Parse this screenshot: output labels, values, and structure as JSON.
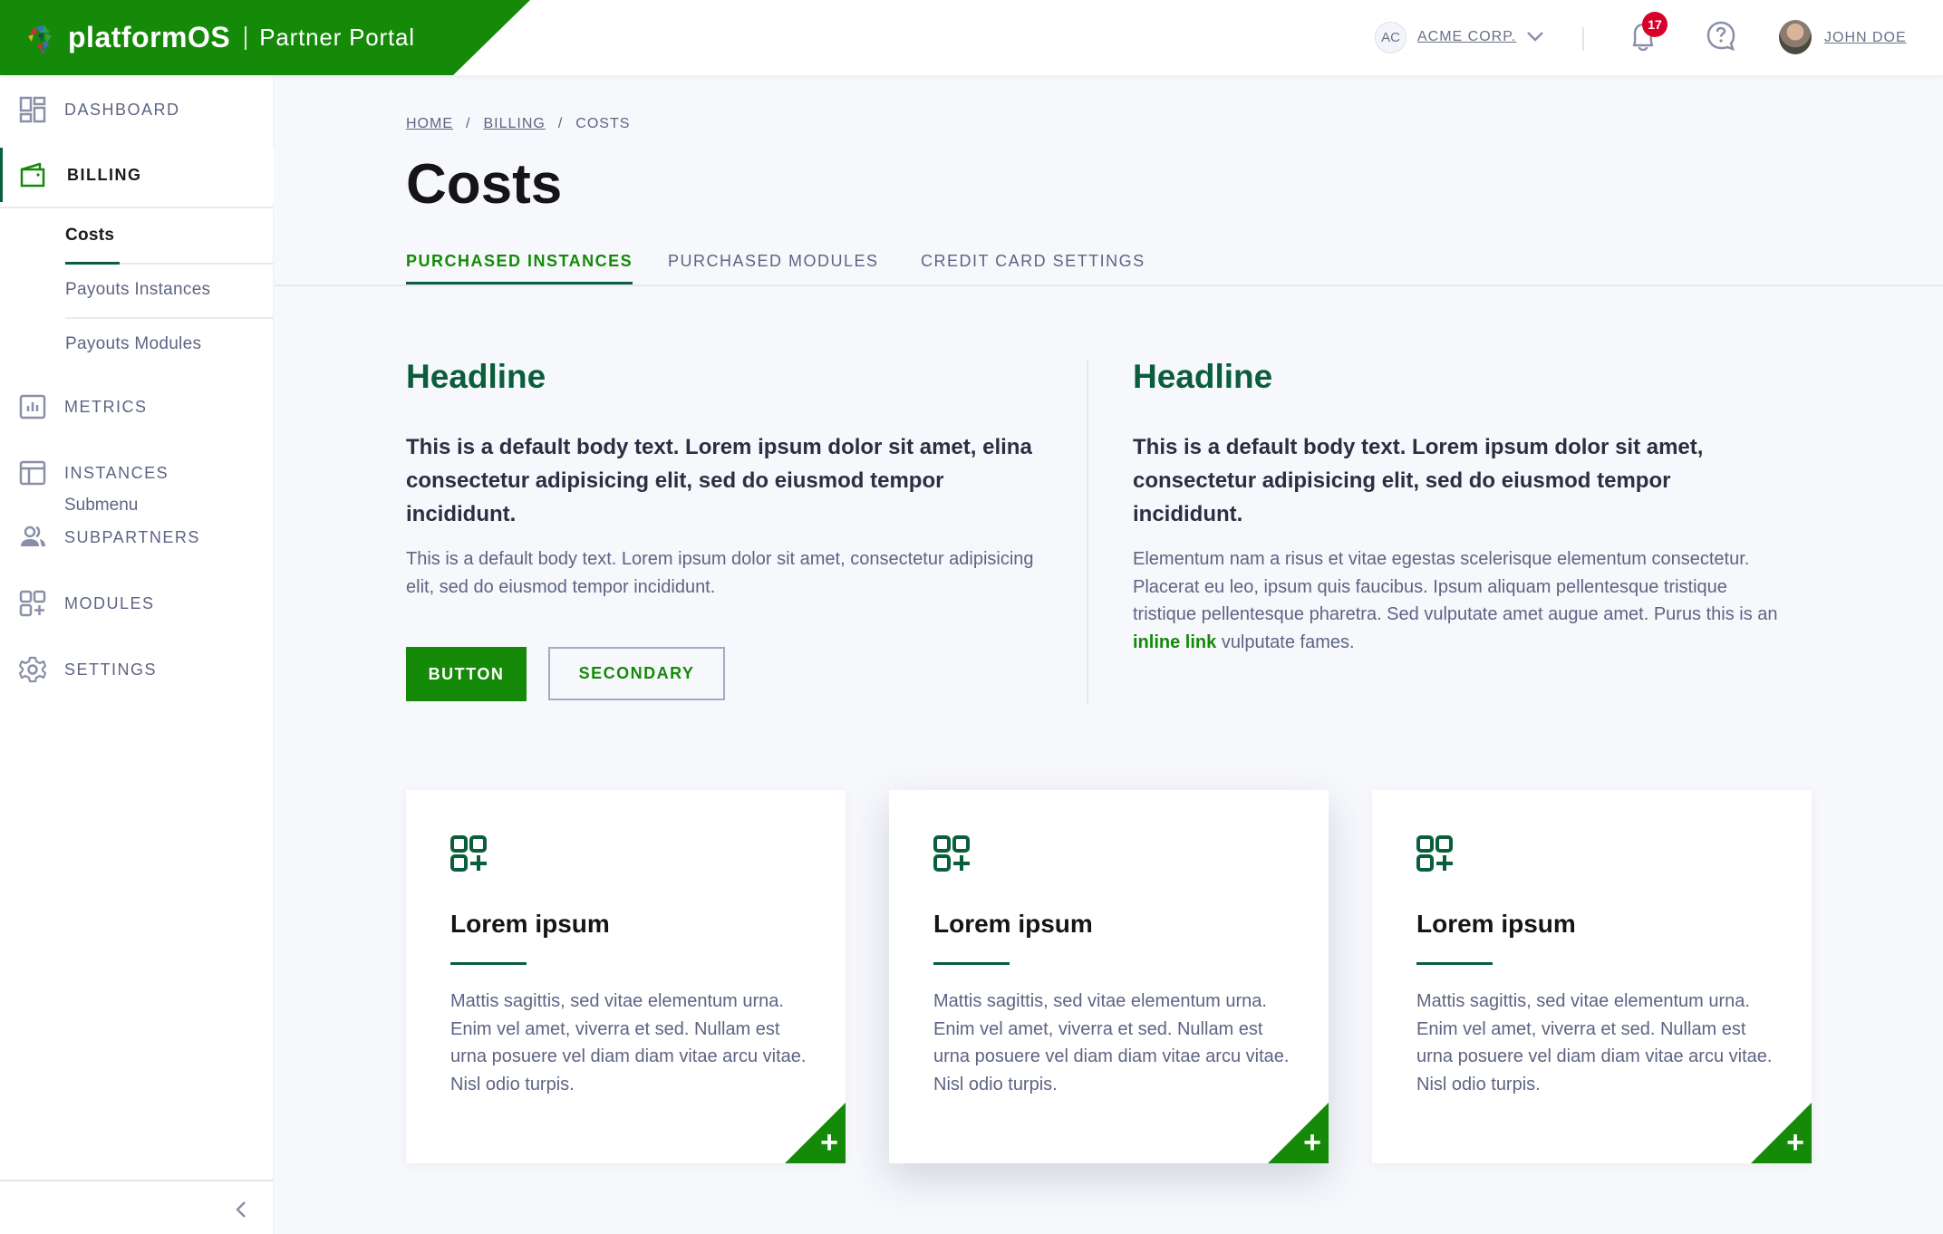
{
  "header": {
    "brand_name": "platformOS",
    "brand_sub": "Partner Portal",
    "org_initials": "AC",
    "org_name": "ACME CORP.",
    "notification_count": "17",
    "user_name": "JOHN DOE",
    "brand_color": "#148a08",
    "badge_color": "#d6002b"
  },
  "sidebar": {
    "items": [
      {
        "label": "DASHBOARD",
        "icon": "dashboard-icon"
      },
      {
        "label": "BILLING",
        "icon": "wallet-icon",
        "active": true
      },
      {
        "label": "METRICS",
        "icon": "bar-chart-icon"
      },
      {
        "label": "INSTANCES",
        "icon": "layout-icon"
      },
      {
        "label": "SUBPARTNERS",
        "icon": "users-icon"
      },
      {
        "label": "MODULES",
        "icon": "modules-icon"
      },
      {
        "label": "SETTINGS",
        "icon": "gear-icon"
      }
    ],
    "billing_sub": [
      {
        "label": "Costs",
        "active": true
      },
      {
        "label": "Payouts Instances"
      },
      {
        "label": "Payouts Modules"
      }
    ],
    "instances_submenu_label": "Submenu"
  },
  "breadcrumb": {
    "items": [
      "HOME",
      "BILLING",
      "COSTS"
    ],
    "separator": "/"
  },
  "page": {
    "title": "Costs",
    "tabs": [
      {
        "label": "PURCHASED INSTANCES",
        "active": true
      },
      {
        "label": "PURCHASED MODULES"
      },
      {
        "label": "CREDIT CARD SETTINGS"
      }
    ]
  },
  "columns": [
    {
      "headline": "Headline",
      "lead": "This is a default body text. Lorem ipsum dolor sit amet, elina consectetur adipisicing elit, sed do eiusmod tempor incididunt.",
      "body": "This is a default body text. Lorem ipsum dolor sit amet, consectetur adipisicing elit, sed do eiusmod tempor incididunt.",
      "primary_button": "BUTTON",
      "secondary_button": "SECONDARY"
    },
    {
      "headline": "Headline",
      "lead": "This is a default body text. Lorem ipsum dolor sit amet, consectetur adipisicing elit, sed do eiusmod tempor incididunt.",
      "body_before_link": "Elementum nam a risus et vitae egestas scelerisque elementum consectetur. Placerat eu leo, ipsum quis faucibus. Ipsum aliquam pellentesque tristique tristique pellentesque pharetra. Sed vulputate amet augue amet. Purus this is an",
      "link_text": "inline link",
      "body_after_link": "vulputate fames."
    }
  ],
  "cards": [
    {
      "title": "Lorem ipsum",
      "text": "Mattis sagittis, sed vitae elementum urna. Enim vel amet, viverra et sed. Nullam est urna posuere vel diam diam vitae arcu vitae. Nisl odio turpis.",
      "add_symbol": "+"
    },
    {
      "title": "Lorem ipsum",
      "text": "Mattis sagittis, sed vitae elementum urna. Enim vel amet, viverra et sed. Nullam est urna posuere vel diam diam vitae arcu vitae. Nisl odio turpis.",
      "add_symbol": "+",
      "hover": true
    },
    {
      "title": "Lorem ipsum",
      "text": "Mattis sagittis, sed vitae elementum urna. Enim vel amet, viverra et sed. Nullam est urna posuere vel diam diam vitae arcu vitae. Nisl odio turpis.",
      "add_symbol": "+"
    }
  ]
}
